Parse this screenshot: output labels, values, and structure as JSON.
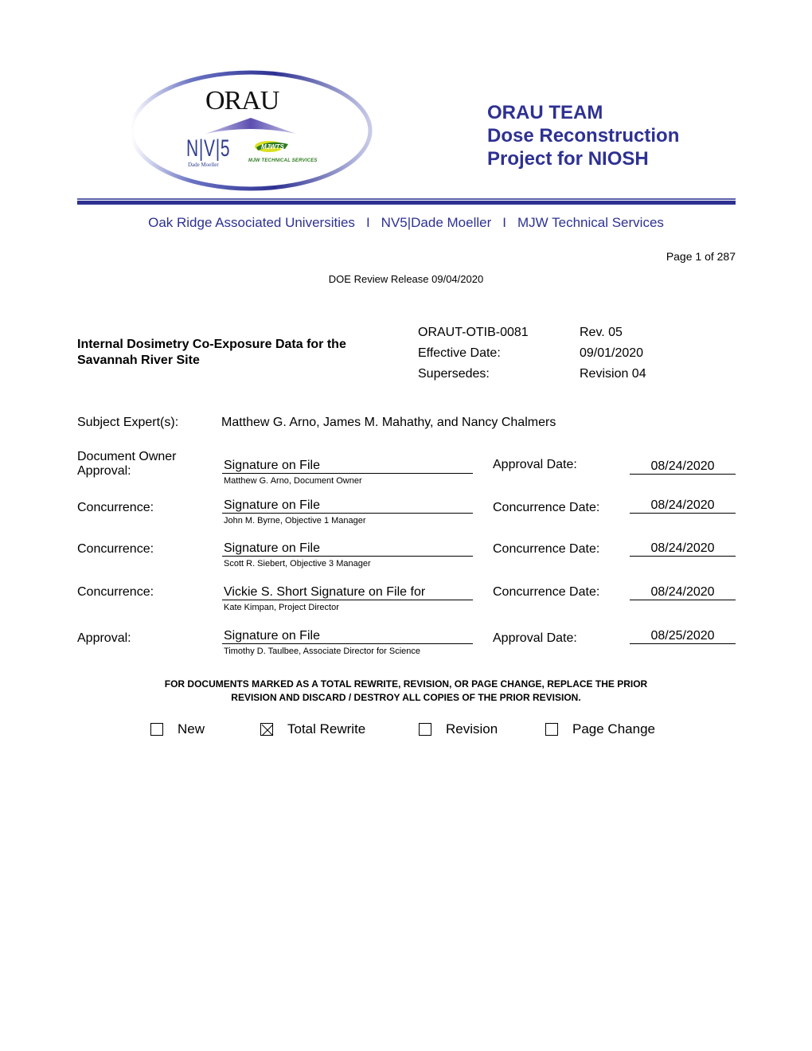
{
  "header": {
    "logo": {
      "orau_wordmark": "ORAU",
      "nv5_wordmark": "N|V|5",
      "nv5_sub": "Dade Moeller",
      "mjwts_wordmark": "MJWTS",
      "mjwts_sub": "MJW TECHNICAL SERVICES"
    },
    "team_title_lines": [
      "ORAU TEAM",
      "Dose Reconstruction",
      "Project for NIOSH"
    ],
    "partners": [
      "Oak Ridge Associated Universities",
      "NV5|Dade Moeller",
      "MJW Technical Services"
    ],
    "partner_separator": "I",
    "brand_color": "#2e3192"
  },
  "page_number": "Page 1 of 287",
  "doe_release": "DOE Review Release 09/04/2020",
  "document": {
    "title": "Internal Dosimetry Co-Exposure Data for the Savannah River Site",
    "meta": [
      {
        "key": "ORAUT-OTIB-0081",
        "value": "Rev. 05"
      },
      {
        "key": "Effective Date:",
        "value": "09/01/2020"
      },
      {
        "key": "Supersedes:",
        "value": "Revision 04"
      }
    ]
  },
  "subject_experts": {
    "label": "Subject Expert(s):",
    "value": "Matthew G. Arno, James M. Mahathy, and Nancy Chalmers"
  },
  "signatures": [
    {
      "label": "Document Owner Approval:",
      "signature": "Signature on File",
      "name": "Matthew G. Arno, Document Owner",
      "date_label": "Approval Date:",
      "date": "08/24/2020"
    },
    {
      "label": "Concurrence:",
      "signature": "Signature on File",
      "name": "John M. Byrne, Objective 1 Manager",
      "date_label": "Concurrence Date:",
      "date": "08/24/2020"
    },
    {
      "label": "Concurrence:",
      "signature": "Signature on File",
      "name": "Scott R. Siebert, Objective 3 Manager",
      "date_label": "Concurrence Date:",
      "date": "08/24/2020"
    },
    {
      "label": "Concurrence:",
      "signature": "Vickie S. Short Signature on File for",
      "name": "Kate Kimpan, Project Director",
      "date_label": "Concurrence Date:",
      "date": "08/24/2020"
    },
    {
      "label": "Approval:",
      "signature": "Signature on File",
      "name": "Timothy D. Taulbee, Associate Director for Science",
      "date_label": "Approval Date:",
      "date": "08/25/2020"
    }
  ],
  "notice": {
    "line1": "FOR DOCUMENTS MARKED AS A TOTAL REWRITE, REVISION, OR PAGE CHANGE, REPLACE THE PRIOR",
    "line2": "REVISION AND DISCARD / DESTROY ALL COPIES OF THE PRIOR REVISION."
  },
  "change_type": [
    {
      "label": "New",
      "checked": false
    },
    {
      "label": "Total Rewrite",
      "checked": true
    },
    {
      "label": "Revision",
      "checked": false
    },
    {
      "label": "Page Change",
      "checked": false
    }
  ]
}
